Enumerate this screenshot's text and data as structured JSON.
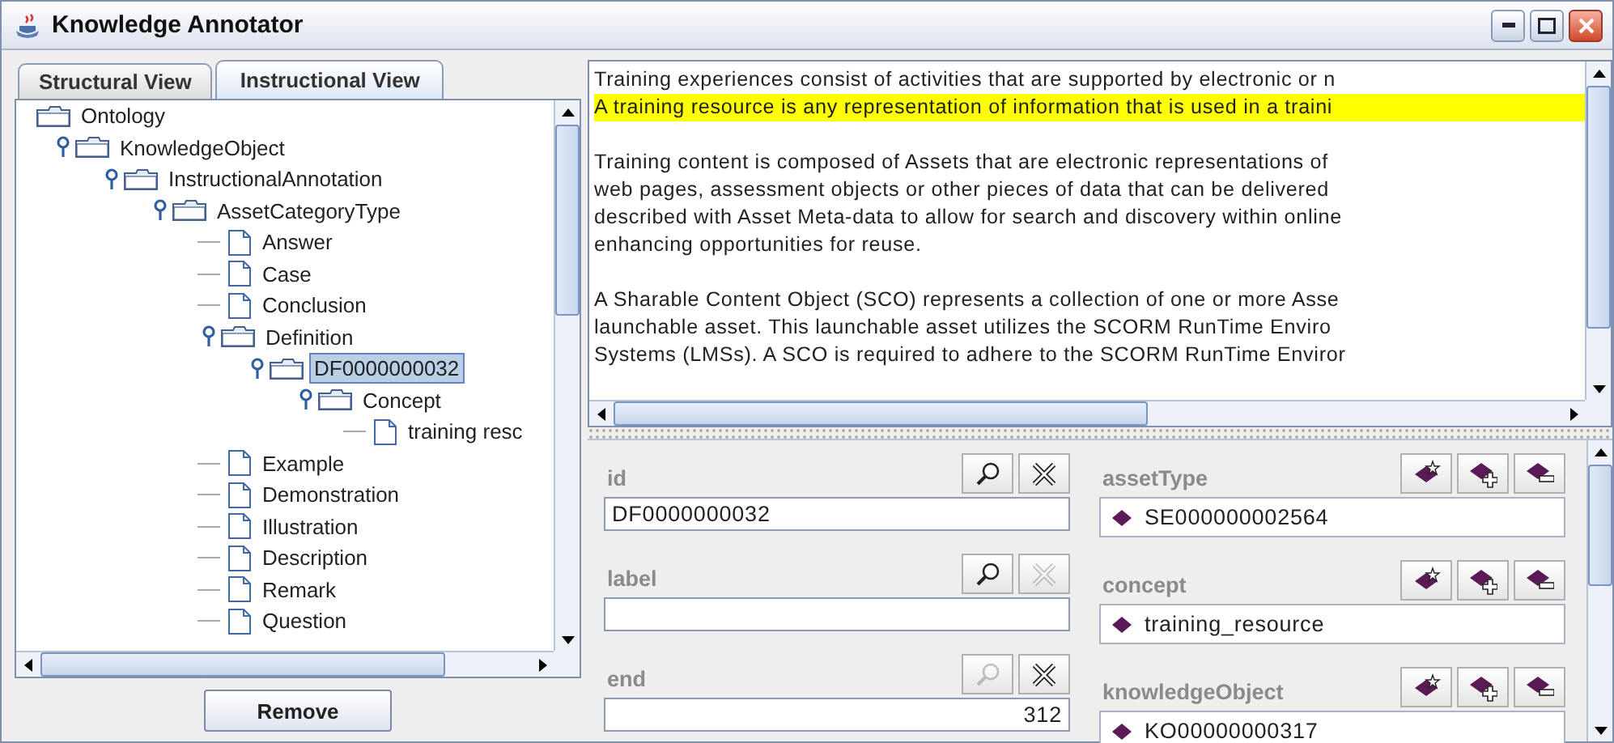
{
  "window": {
    "title": "Knowledge Annotator",
    "controls": [
      {
        "kind": "minimize"
      },
      {
        "kind": "maximize"
      },
      {
        "kind": "close"
      }
    ]
  },
  "tabs": [
    {
      "label": "Structural View",
      "selected": false
    },
    {
      "label": "Instructional View",
      "selected": true
    }
  ],
  "tree": {
    "nodes": [
      {
        "label": "Ontology",
        "kind": "folder",
        "selected": false,
        "expanded": true,
        "children": [
          {
            "label": "KnowledgeObject",
            "kind": "folder",
            "selected": false,
            "expanded": true,
            "children": [
              {
                "label": "InstructionalAnnotation",
                "kind": "folder",
                "selected": false,
                "expanded": true,
                "children": [
                  {
                    "label": "AssetCategoryType",
                    "kind": "folder",
                    "selected": false,
                    "expanded": true,
                    "children": [
                      {
                        "label": "Answer",
                        "kind": "document",
                        "selected": false
                      },
                      {
                        "label": "Case",
                        "kind": "document",
                        "selected": false
                      },
                      {
                        "label": "Conclusion",
                        "kind": "document",
                        "selected": false
                      },
                      {
                        "label": "Definition",
                        "kind": "folder",
                        "selected": false,
                        "expanded": true,
                        "children": [
                          {
                            "label": "DF0000000032",
                            "kind": "folder",
                            "selected": true,
                            "expanded": true,
                            "children": [
                              {
                                "label": "Concept",
                                "kind": "folder",
                                "selected": false,
                                "expanded": true,
                                "children": [
                                  {
                                    "label": "training resc",
                                    "kind": "document",
                                    "selected": false
                                  }
                                ]
                              }
                            ]
                          }
                        ]
                      },
                      {
                        "label": "Example",
                        "kind": "document",
                        "selected": false
                      },
                      {
                        "label": "Demonstration",
                        "kind": "document",
                        "selected": false
                      },
                      {
                        "label": "Illustration",
                        "kind": "document",
                        "selected": false
                      },
                      {
                        "label": "Description",
                        "kind": "document",
                        "selected": false
                      },
                      {
                        "label": "Remark",
                        "kind": "document",
                        "selected": false
                      },
                      {
                        "label": "Question",
                        "kind": "document",
                        "selected": false
                      }
                    ]
                  }
                ]
              }
            ]
          }
        ]
      }
    ]
  },
  "remove_button": "Remove",
  "text_pane": {
    "paragraphs": [
      {
        "lines": [
          {
            "text": "Training experiences consist of activities that are supported by electronic or n",
            "highlighted": false
          },
          {
            "text": "A training resource is any representation of information that is used in a traini",
            "highlighted": true
          }
        ]
      },
      {
        "lines": [
          {
            "text": "Training content is composed of Assets that are electronic representations of",
            "highlighted": false
          },
          {
            "text": "web pages, assessment objects or other pieces of data that can be delivered",
            "highlighted": false
          },
          {
            "text": "described with Asset Meta-data to allow for search and discovery within online",
            "highlighted": false
          },
          {
            "text": "enhancing opportunities for reuse.",
            "highlighted": false
          }
        ]
      },
      {
        "lines": [
          {
            "text": "A Sharable Content Object (SCO) represents a collection of one or more Asse",
            "highlighted": false
          },
          {
            "text": "launchable asset. This launchable asset utilizes the SCORM RunTime Enviro",
            "highlighted": false
          },
          {
            "text": "Systems (LMSs). A SCO is required to adhere to the SCORM RunTime Enviror",
            "highlighted": false
          }
        ]
      }
    ]
  },
  "properties": [
    {
      "label": "id",
      "value": "DF0000000032",
      "kind": "text",
      "buttons": [
        {
          "kind": "search",
          "disabled": false
        },
        {
          "kind": "clear",
          "disabled": false
        }
      ]
    },
    {
      "label": "label",
      "kind": "text",
      "buttons": [
        {
          "kind": "search",
          "disabled": false
        },
        {
          "kind": "clear",
          "disabled": true
        }
      ]
    },
    {
      "label": "end",
      "value": "312",
      "kind": "number",
      "buttons": [
        {
          "kind": "search",
          "disabled": true
        },
        {
          "kind": "clear",
          "disabled": false
        }
      ]
    }
  ],
  "relations": [
    {
      "label": "assetType",
      "value": "SE000000002564",
      "buttons": [
        {
          "kind": "new"
        },
        {
          "kind": "add"
        },
        {
          "kind": "remove"
        }
      ]
    },
    {
      "label": "concept",
      "value": "training_resource",
      "buttons": [
        {
          "kind": "new"
        },
        {
          "kind": "add"
        },
        {
          "kind": "remove"
        }
      ]
    },
    {
      "label": "knowledgeObject",
      "value": "KO00000000317",
      "buttons": [
        {
          "kind": "new"
        },
        {
          "kind": "add"
        },
        {
          "kind": "remove"
        }
      ]
    }
  ]
}
